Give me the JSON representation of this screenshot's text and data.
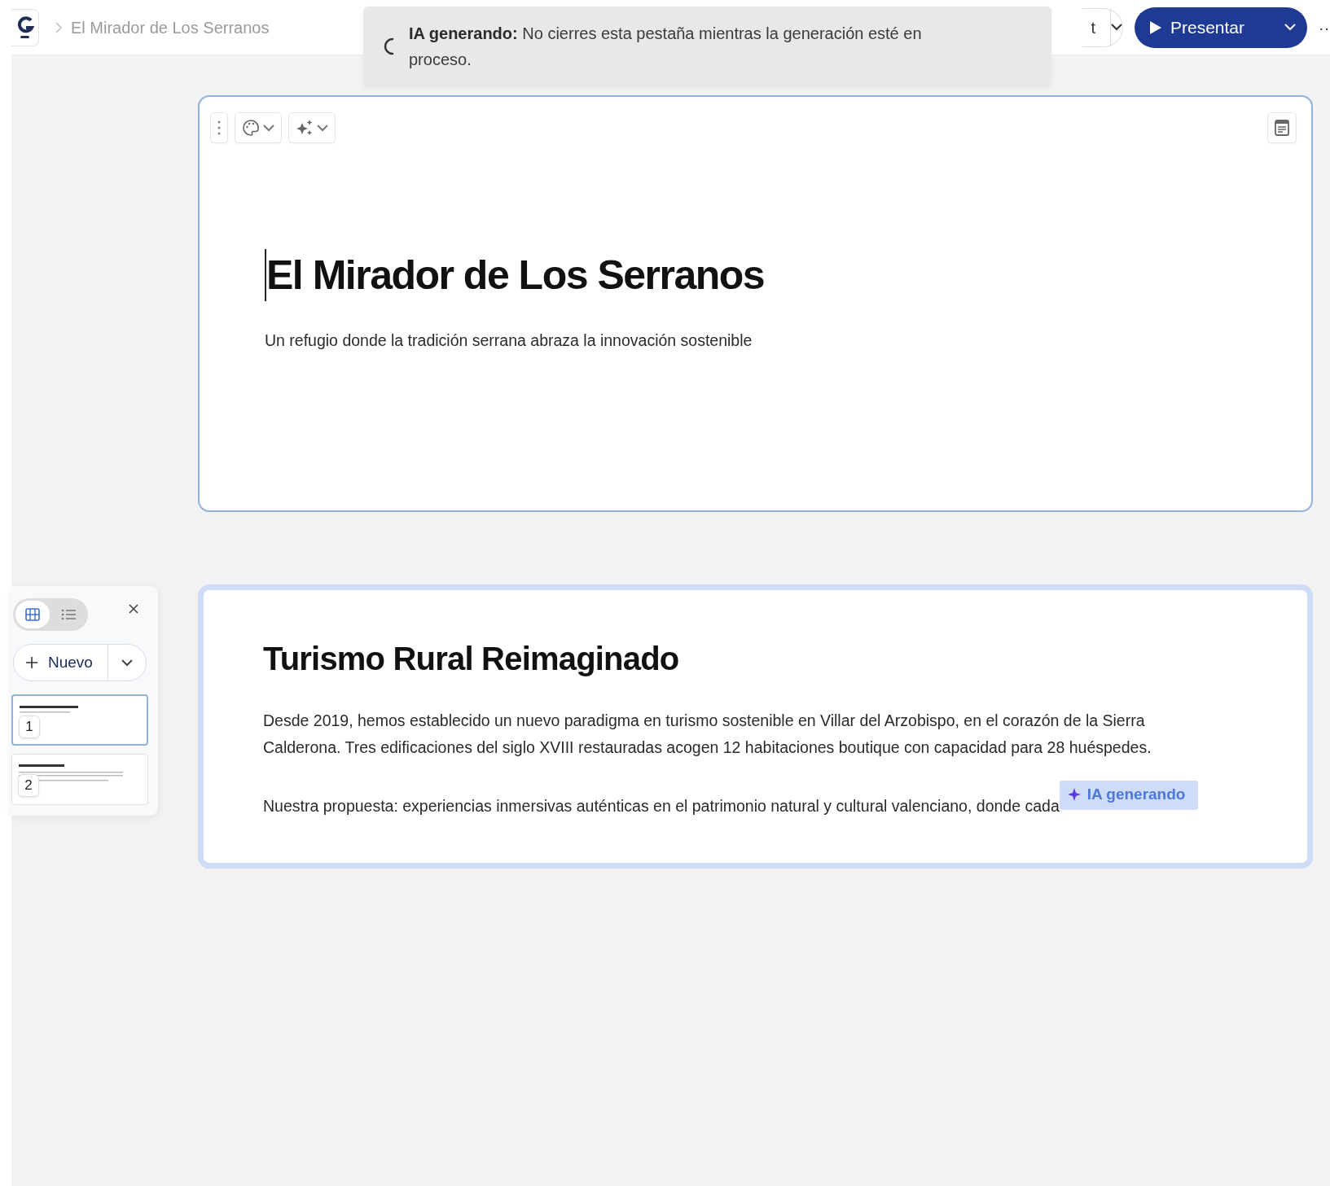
{
  "topbar": {
    "breadcrumb": "El Mirador de Los Serranos",
    "partial_button": "t",
    "present_button": "Presentar",
    "more": "··"
  },
  "toast": {
    "text": "**IA generando:** No cierres esta pestaña mientras la generación esté en proceso."
  },
  "cards": [
    {
      "kind": "title",
      "selected": true,
      "generating": false,
      "title": "El Mirador de Los Serranos",
      "paragraphs": [
        "Un refugio donde la tradición serrana abraza la innovación sostenible"
      ]
    },
    {
      "kind": "text",
      "selected": false,
      "generating": true,
      "title": "Turismo Rural Reimaginado",
      "paragraphs": [
        "Desde 2019, hemos establecido un nuevo paradigma en turismo sostenible en Villar del Arzobispo, en el corazón de la Sierra Calderona. Tres edificaciones del siglo XVIII restauradas acogen 12 habitaciones boutique con capacidad para 28 huéspedes.",
        "Nuestra propuesta: experiencias inmersivas auténticas en el patrimonio natural y cultural valenciano, donde cada"
      ],
      "badge": "IA generando"
    }
  ],
  "slide_panel": {
    "views": [
      {
        "kind": "grid",
        "selected": true
      },
      {
        "kind": "list",
        "selected": false
      }
    ],
    "new_button": "Nuevo",
    "slides": [
      {
        "number": "1",
        "selected": true
      },
      {
        "number": "2",
        "selected": false
      }
    ]
  }
}
